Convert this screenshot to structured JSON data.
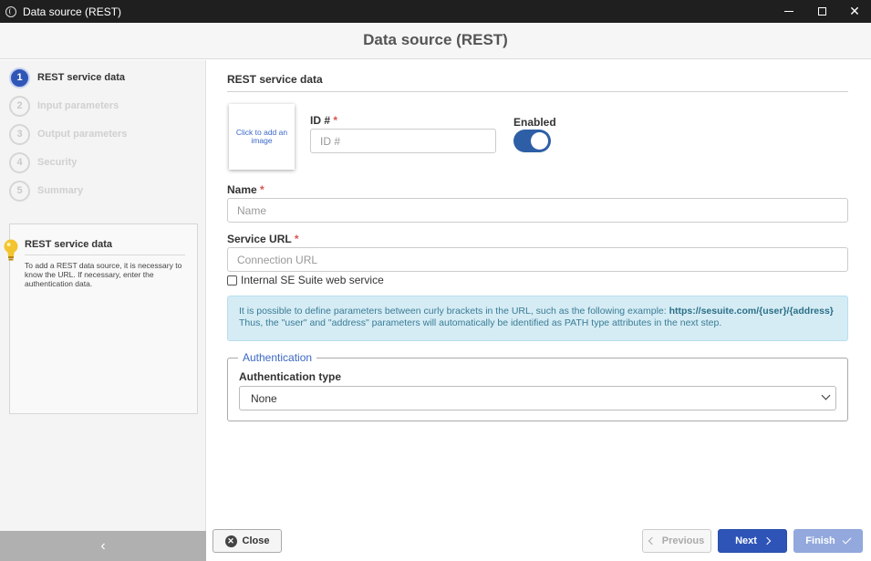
{
  "window": {
    "title": "Data source (REST)",
    "minimize_icon": "minimize-icon",
    "maximize_icon": "maximize-icon",
    "close_icon": "close-icon",
    "close_glyph": "✕"
  },
  "header": {
    "title": "Data source (REST)"
  },
  "steps": [
    {
      "num": "1",
      "label": "REST service data",
      "active": true
    },
    {
      "num": "2",
      "label": "Input parameters",
      "active": false
    },
    {
      "num": "3",
      "label": "Output parameters",
      "active": false
    },
    {
      "num": "4",
      "label": "Security",
      "active": false
    },
    {
      "num": "5",
      "label": "Summary",
      "active": false
    }
  ],
  "help": {
    "title": "REST service data",
    "text": "To add a REST data source, it is necessary to know the URL. If necessary, enter the authentication data.",
    "icon": "lightbulb-icon"
  },
  "sidebar": {
    "collapse_glyph": "‹"
  },
  "main": {
    "section_title": "REST service data",
    "image_placeholder": "Click to add an image",
    "id": {
      "label": "ID #",
      "required": "*",
      "placeholder": "ID #"
    },
    "enabled": {
      "label": "Enabled",
      "on": true
    },
    "name": {
      "label": "Name",
      "required": "*",
      "placeholder": "Name"
    },
    "service_url": {
      "label": "Service URL",
      "required": "*",
      "placeholder": "Connection URL"
    },
    "internal": {
      "label": "Internal SE Suite web service",
      "checked": false
    },
    "info": {
      "line1": "It is possible to define parameters between curly brackets in the URL, such as the following example:",
      "example": "https://sesuite.com/{user}/{address}",
      "line2": "Thus, the \"user\" and \"address\" parameters will automatically be identified as PATH type attributes in the next step."
    },
    "authentication": {
      "legend": "Authentication",
      "type_label": "Authentication type",
      "type_value": "None"
    }
  },
  "footer": {
    "close": "Close",
    "previous": "Previous",
    "next": "Next",
    "finish": "Finish"
  },
  "colors": {
    "accent": "#2e54b8",
    "toggle": "#2e5fa6",
    "info_bg": "#d5ecf5",
    "required": "#d9534f"
  }
}
